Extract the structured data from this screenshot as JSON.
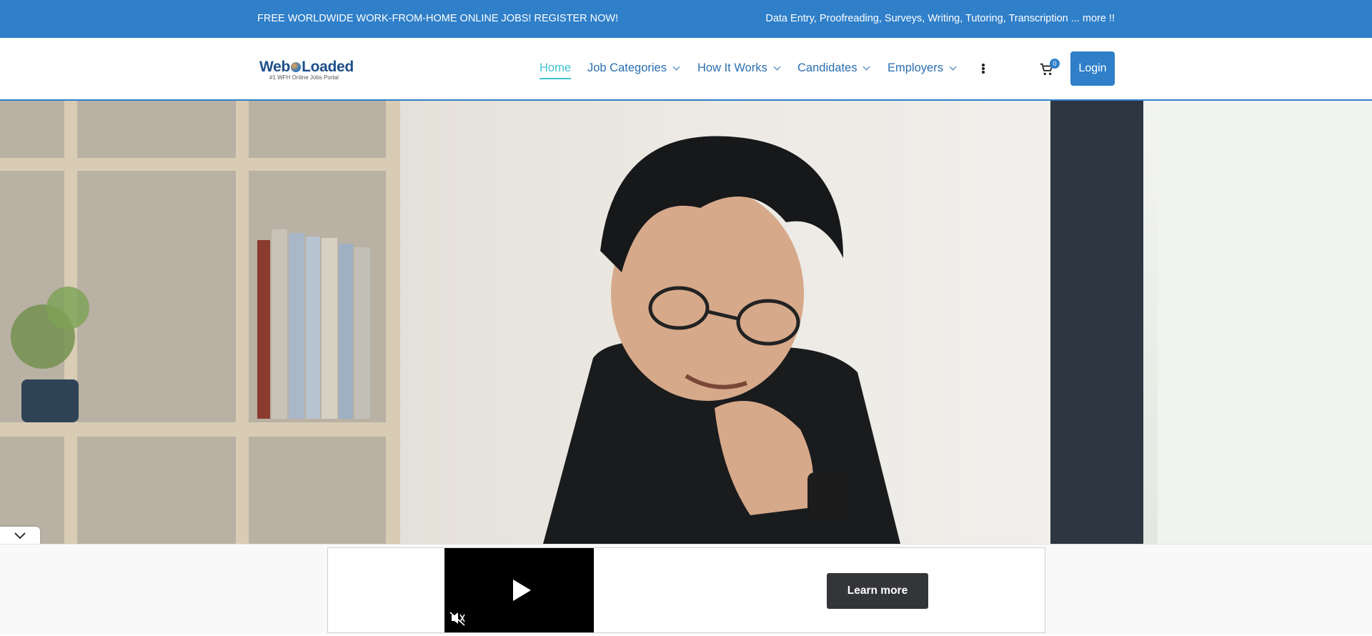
{
  "topbar": {
    "left_text": "FREE WORLDWIDE WORK-FROM-HOME ONLINE JOBS! REGISTER NOW!",
    "right_text": "Data Entry, Proofreading, Surveys, Writing, Tutoring, Transcription ... more !!"
  },
  "logo": {
    "name_part1": "Web",
    "name_part2": "Loaded",
    "tagline": "#1 WFH Online Jobs Portal"
  },
  "nav": {
    "items": [
      {
        "label": "Home",
        "active": true,
        "dropdown": false
      },
      {
        "label": "Job Categories",
        "active": false,
        "dropdown": true
      },
      {
        "label": "How It Works",
        "active": false,
        "dropdown": true
      },
      {
        "label": "Candidates",
        "active": false,
        "dropdown": true
      },
      {
        "label": "Employers",
        "active": false,
        "dropdown": true
      }
    ],
    "more_icon": "kebab-icon"
  },
  "cart": {
    "icon": "cart-icon",
    "count": "0"
  },
  "login_label": "Login",
  "ad": {
    "learn_more_label": "Learn more",
    "play_icon": "play-icon",
    "mute_icon": "muted-speaker-icon",
    "collapse_icon": "chevron-down-icon"
  },
  "colors": {
    "brand_blue": "#2f7fc9",
    "active_nav": "#3fc3d6",
    "nav_text": "#2a6fb0"
  }
}
